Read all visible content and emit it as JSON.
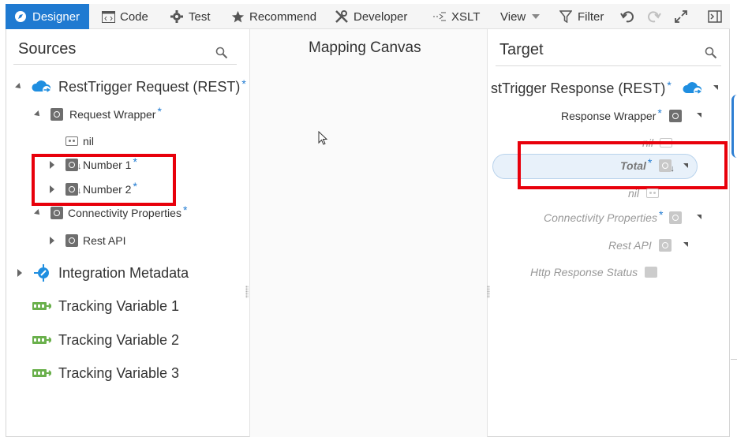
{
  "toolbar": {
    "designer": "Designer",
    "code": "Code",
    "test": "Test",
    "recommend": "Recommend",
    "developer": "Developer",
    "xslt": "XSLT",
    "view": "View",
    "filter": "Filter"
  },
  "sources": {
    "title": "Sources",
    "root": "RestTrigger Request (REST)",
    "request_wrapper": "Request Wrapper",
    "nil": "nil",
    "number1": "Number 1",
    "number2": "Number 2",
    "connectivity": "Connectivity Properties",
    "rest_api": "Rest API",
    "integration_metadata": "Integration Metadata",
    "tracking": [
      "Tracking Variable 1",
      "Tracking Variable 2",
      "Tracking Variable 3"
    ]
  },
  "canvas": {
    "title": "Mapping Canvas"
  },
  "target": {
    "title": "Target",
    "root": "stTrigger Response (REST)",
    "response_wrapper": "Response Wrapper",
    "nil_top": "nil",
    "total": "Total",
    "nil": "nil",
    "connectivity": "Connectivity Properties",
    "rest_api": "Rest API",
    "http_status": "Http Response Status"
  },
  "required_marker": "*",
  "colors": {
    "accent": "#1f7ad1",
    "highlight": "#e8000b",
    "tracking": "#6ab04c"
  }
}
